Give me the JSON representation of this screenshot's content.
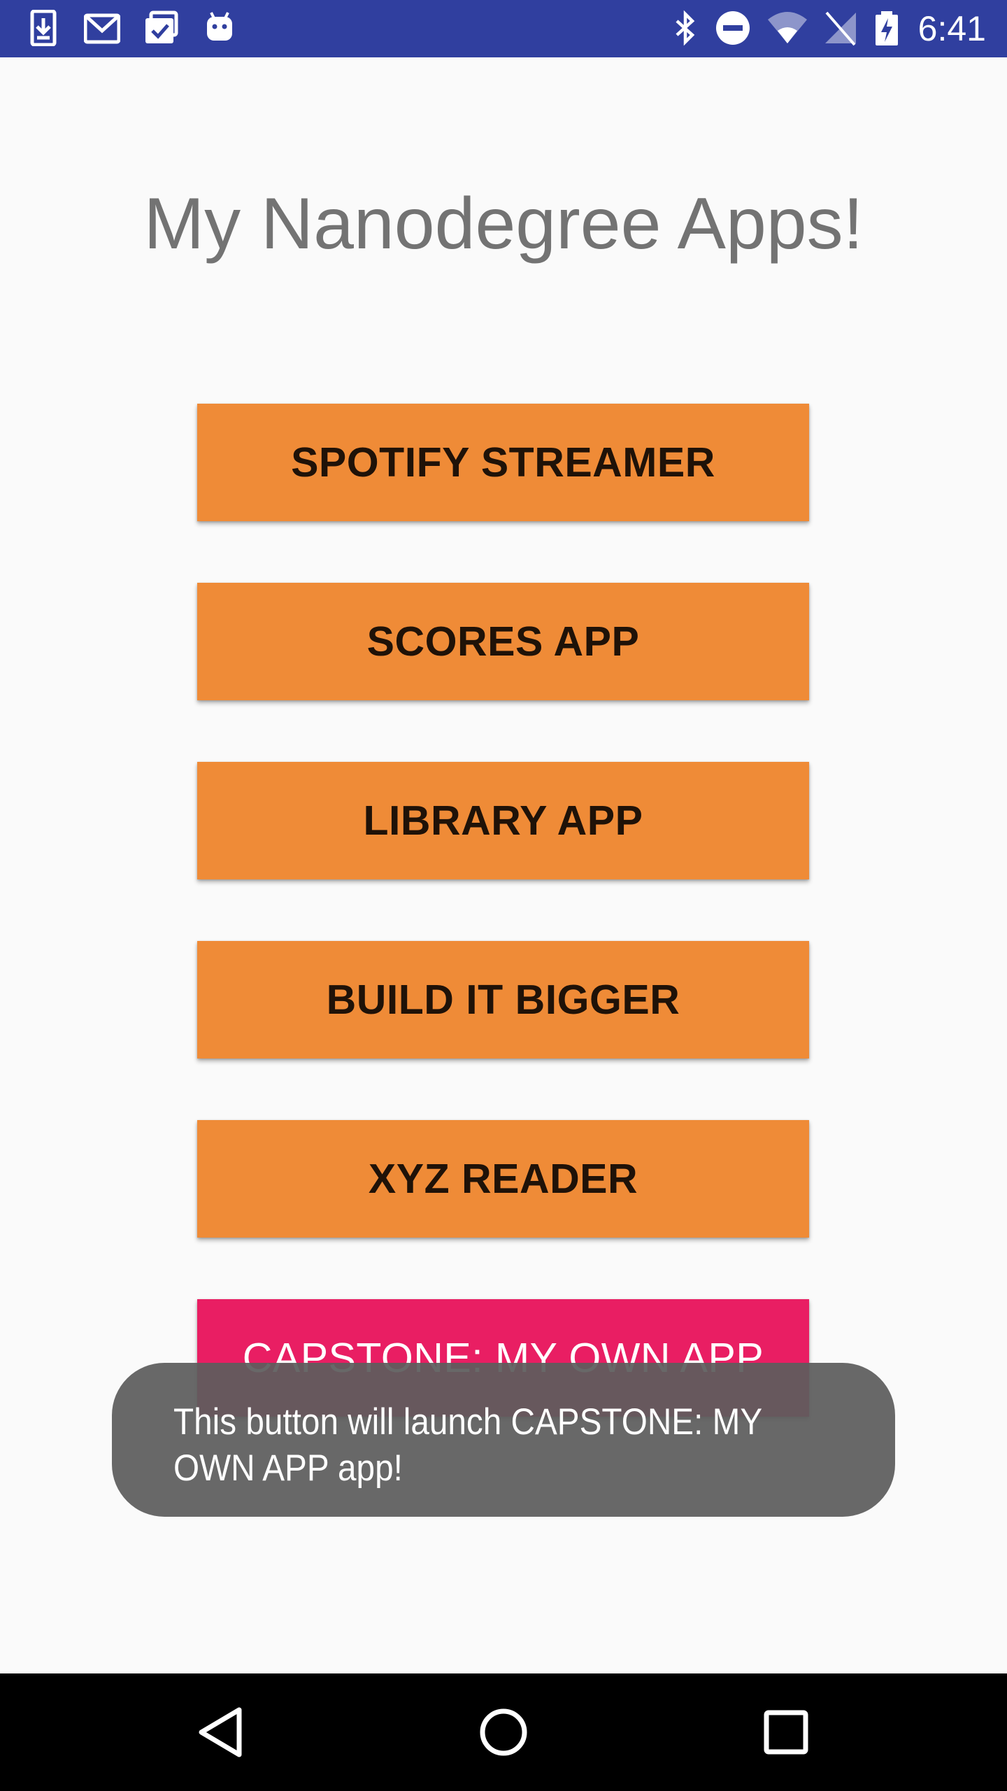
{
  "status_bar": {
    "time": "6:41",
    "left_icons": [
      "download-notification-icon",
      "gmail-icon",
      "task-check-icon",
      "android-icon"
    ],
    "right_icons": [
      "bluetooth-icon",
      "do-not-disturb-icon",
      "wifi-icon",
      "no-signal-icon",
      "battery-charging-icon"
    ],
    "background_color": "#303f9f"
  },
  "main": {
    "title": "My Nanodegree Apps!",
    "buttons": [
      {
        "label": "SPOTIFY STREAMER"
      },
      {
        "label": "SCORES APP"
      },
      {
        "label": "LIBRARY APP"
      },
      {
        "label": "BUILD IT BIGGER"
      },
      {
        "label": "XYZ READER"
      },
      {
        "label": "CAPSTONE: MY OWN APP"
      }
    ],
    "button_color": "#ef8b37",
    "accent_button_color": "#e91e63"
  },
  "toast": {
    "message": "This button will launch CAPSTONE: MY OWN APP app!"
  },
  "nav_bar": {
    "icons": [
      "back-icon",
      "home-icon",
      "recents-icon"
    ]
  }
}
